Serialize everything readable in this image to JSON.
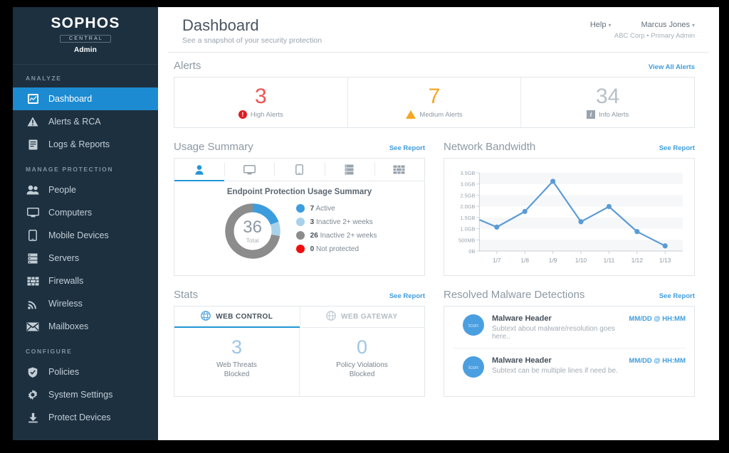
{
  "sidebar": {
    "brand_name": "SOPHOS",
    "brand_central": "CENTRAL",
    "brand_role": "Admin",
    "groups": [
      {
        "title": "ANALYZE",
        "items": [
          {
            "label": "Dashboard",
            "icon": "dashboard-icon",
            "active": true
          },
          {
            "label": "Alerts & RCA",
            "icon": "warning-triangle-icon",
            "active": false
          },
          {
            "label": "Logs & Reports",
            "icon": "report-document-icon",
            "active": false
          }
        ]
      },
      {
        "title": "MANAGE PROTECTION",
        "items": [
          {
            "label": "People",
            "icon": "people-icon",
            "active": false
          },
          {
            "label": "Computers",
            "icon": "monitor-icon",
            "active": false
          },
          {
            "label": "Mobile Devices",
            "icon": "mobile-phone-icon",
            "active": false
          },
          {
            "label": "Servers",
            "icon": "server-rack-icon",
            "active": false
          },
          {
            "label": "Firewalls",
            "icon": "firewall-icon",
            "active": false
          },
          {
            "label": "Wireless",
            "icon": "wifi-icon",
            "active": false
          },
          {
            "label": "Mailboxes",
            "icon": "envelope-icon",
            "active": false
          }
        ]
      },
      {
        "title": "CONFIGURE",
        "items": [
          {
            "label": "Policies",
            "icon": "shield-check-icon",
            "active": false
          },
          {
            "label": "System Settings",
            "icon": "gear-icon",
            "active": false
          },
          {
            "label": "Protect Devices",
            "icon": "download-icon",
            "active": false
          }
        ]
      }
    ]
  },
  "header": {
    "title": "Dashboard",
    "subtitle": "See a snapshot of your security protection",
    "help_label": "Help",
    "user_name": "Marcus Jones",
    "user_org": "ABC Corp • Primary Admin"
  },
  "alerts": {
    "section_title": "Alerts",
    "view_all_label": "View All Alerts",
    "items": [
      {
        "count": "3",
        "label": "High Alerts",
        "icon": "high-alert-icon",
        "glyph": "!",
        "color": "#ef5350"
      },
      {
        "count": "7",
        "label": "Medium Alerts",
        "icon": "medium-alert-icon",
        "glyph": "",
        "color": "#f5a623"
      },
      {
        "count": "34",
        "label": "Info Alerts",
        "icon": "info-alert-icon",
        "glyph": "i",
        "color": "#b7c0c8"
      }
    ]
  },
  "usage_summary": {
    "section_title": "Usage Summary",
    "see_report_label": "See Report",
    "tabs": [
      {
        "icon": "person-icon",
        "active": true
      },
      {
        "icon": "monitor-icon",
        "active": false
      },
      {
        "icon": "mobile-phone-icon",
        "active": false
      },
      {
        "icon": "server-rack-icon",
        "active": false
      },
      {
        "icon": "firewall-icon",
        "active": false
      }
    ],
    "chart_title": "Endpoint Protection Usage Summary",
    "donut_total": "36",
    "donut_caption": "Total",
    "legend": [
      {
        "value": "7",
        "label": "Active",
        "color": "#3b9ddd"
      },
      {
        "value": "3",
        "label": "Inactive 2+ weeks",
        "color": "#a9d1ea"
      },
      {
        "value": "26",
        "label": "Inactive 2+ weeks",
        "color": "#8c8c8c"
      },
      {
        "value": "0",
        "label": "Not protected",
        "color": "#f20d0d"
      }
    ]
  },
  "network_bandwidth": {
    "section_title": "Network Bandwidth",
    "see_report_label": "See Report"
  },
  "stats": {
    "section_title": "Stats",
    "see_report_label": "See Report",
    "tabs": [
      {
        "label": "WEB CONTROL",
        "icon": "globe-icon",
        "active": true
      },
      {
        "label": "WEB GATEWAY",
        "icon": "globe-outline-icon",
        "active": false
      }
    ],
    "cells": [
      {
        "value": "3",
        "caption": "Web Threats\nBlocked"
      },
      {
        "value": "0",
        "caption": "Policy Violations\nBlocked"
      }
    ]
  },
  "malware": {
    "section_title": "Resolved Malware Detections",
    "see_report_label": "See Report",
    "rows": [
      {
        "avatar": "Icon",
        "header": "Malware Header",
        "subtext": "Subtext about malware/resolution goes here..",
        "time": "MM/DD @ HH:MM"
      },
      {
        "avatar": "Icon",
        "header": "Malware Header",
        "subtext": "Subtext can be multiple lines if need be.",
        "time": "MM/DD @ HH:MM"
      }
    ]
  },
  "chart_data": {
    "type": "line",
    "title": "Network Bandwidth",
    "xlabel": "",
    "ylabel": "",
    "x": [
      "1/7",
      "1/8",
      "1/9",
      "1/10",
      "1/11",
      "1/12",
      "1/13"
    ],
    "categories": [
      "1/7",
      "1/8",
      "1/9",
      "1/10",
      "1/11",
      "1/12",
      "1/13"
    ],
    "values": [
      1.07,
      1.77,
      3.12,
      1.31,
      1.99,
      0.87,
      0.23
    ],
    "units": "GB",
    "ytick_labels": [
      "0B",
      "500MB",
      "1.0GB",
      "1.5GB",
      "2.0GB",
      "2.5GB",
      "3.0GB",
      "3.5GB"
    ],
    "ytick_values": [
      0,
      0.5,
      1.0,
      1.5,
      2.0,
      2.5,
      3.0,
      3.5
    ],
    "ylim": [
      0,
      3.5
    ],
    "grid": "horizontal-banded",
    "legend": "none",
    "line_color": "#5b9bd5",
    "marker": "circle"
  },
  "donut_data": {
    "type": "pie",
    "title": "Endpoint Protection Usage Summary",
    "total": 36,
    "labels": [
      "Active",
      "Inactive 2+ weeks",
      "Inactive 2+ weeks",
      "Not protected"
    ],
    "values": [
      7,
      3,
      26,
      0
    ],
    "colors": [
      "#3b9ddd",
      "#a9d1ea",
      "#8c8c8c",
      "#f20d0d"
    ]
  }
}
